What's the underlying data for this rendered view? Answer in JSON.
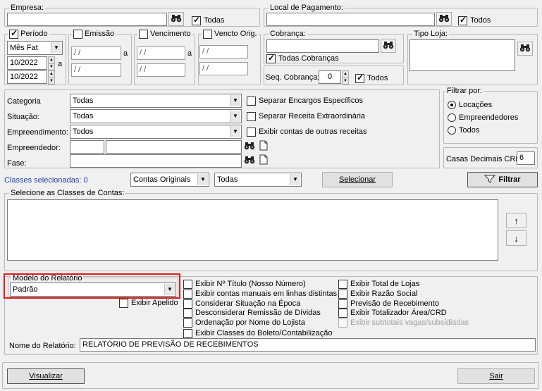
{
  "empresa": {
    "legend": "Empresa:",
    "value": "",
    "todas": "Todas"
  },
  "local_pagamento": {
    "legend": "Local de Pagamento:",
    "value": "",
    "todos": "Todos"
  },
  "periodo": {
    "legend": "Período",
    "select": "Mês Fat",
    "date_from": "10/2022",
    "date_to": "10/2022",
    "sep": "a"
  },
  "emissao": {
    "legend": "Emissão",
    "from": "/ /",
    "to": "/ /",
    "sep": "a"
  },
  "vencimento": {
    "legend": "Vencimento",
    "from": "/ /",
    "to": "/ /",
    "sep": "a"
  },
  "vencto_orig": {
    "legend": "Vencto Orig.",
    "from": "/ /",
    "to": "/ /"
  },
  "cobranca": {
    "legend": "Cobrança:",
    "value": "",
    "todas": "Todas Cobranças"
  },
  "seq_cobranca": {
    "label": "Seq. Cobrança:",
    "value": "0",
    "todos": "Todos"
  },
  "tipo_loja": {
    "legend": "Tipo Loja:",
    "value": ""
  },
  "filters": {
    "categoria_label": "Categoria",
    "categoria": "Todas",
    "situacao_label": "Situação:",
    "situacao": "Todas",
    "empreendimento_label": "Empreendimento:",
    "empreendimento": "Todos",
    "empreendedor_label": "Empreendedor:",
    "fase_label": "Fase:",
    "separar_encargos": "Separar Encargos Específicos",
    "separar_receita": "Separar Receita Extraordinária",
    "exibir_contas": "Exibir contas de outras receitas"
  },
  "filtrar_por": {
    "legend": "Filtrar por:",
    "options": [
      "Locações",
      "Empreendedores",
      "Todos"
    ],
    "selected": 0
  },
  "casas_decimais": {
    "label": "Casas Decimais CRD",
    "value": "6"
  },
  "classes": {
    "selecionadas": "Classes selecionadas: 0",
    "combo1": "Contas Originais",
    "combo2": "Todas",
    "selecionar": "Selecionar",
    "filtrar": "Filtrar",
    "legend": "Selecione as Classes de Contas:",
    "up": "↑",
    "down": "↓"
  },
  "modelo": {
    "legend": "Modelo do Relatório",
    "value": "Padrão",
    "exibir_apelido": "Exibir Apelido"
  },
  "options_col1": [
    "Exibir Nº Título (Nosso Número)",
    "Exibir contas manuais em linhas distintas",
    "Considerar Situação na Época",
    "Desconsiderar Remissão de Dívidas",
    "Ordenação por Nome do Lojista",
    "Exibir Classes do Boleto/Contabilização"
  ],
  "options_col2": [
    "Exibir Total de Lojas",
    "Exibir Razão Social",
    "Previsão de Recebimento",
    "Exibir Totalizador Área/CRD",
    "Exibir subtotais vagas/subsidiadas"
  ],
  "nome_relatorio": {
    "label": "Nome do Relatório:",
    "value": "RELATÓRIO DE PREVISÃO DE RECEBIMENTOS"
  },
  "footer": {
    "visualizar": "Visualizar",
    "sair": "Sair"
  },
  "colors": {
    "highlight": "#e11a1a",
    "link": "#1f3fa8"
  }
}
